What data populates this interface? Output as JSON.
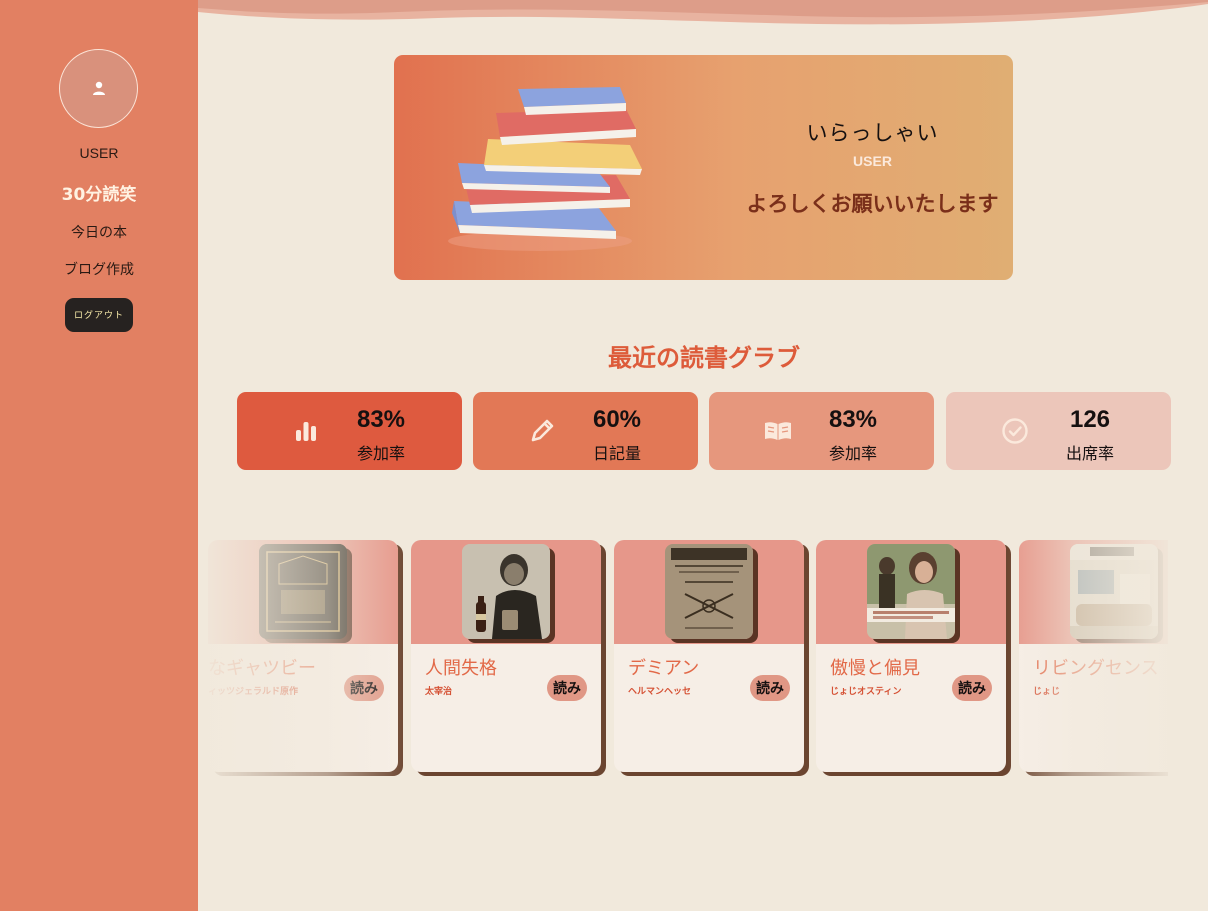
{
  "sidebar": {
    "username": "USER",
    "brand": "30分読笑",
    "nav": [
      {
        "label": "今日の本"
      },
      {
        "label": "ブログ作成"
      }
    ],
    "logout_label": "ログアウト"
  },
  "hero": {
    "greeting": "いらっしゃい",
    "username": "USER",
    "message": "よろしくお願いいたします"
  },
  "stats_section": {
    "title": "最近の読書グラブ",
    "cards": [
      {
        "value": "83%",
        "label": "参加率",
        "icon": "bar-chart-icon"
      },
      {
        "value": "60%",
        "label": "日記量",
        "icon": "pencil-icon"
      },
      {
        "value": "83%",
        "label": "参加率",
        "icon": "open-book-icon"
      },
      {
        "value": "126",
        "label": "出席率",
        "icon": "check-circle-icon"
      }
    ]
  },
  "books": [
    {
      "title": "グレートなギャツビー",
      "title_visible": "なギャツビー",
      "author": "フィッツジェラルド原作",
      "author_visible": "ィッツジェラルド原作",
      "read_label": "読み"
    },
    {
      "title": "人間失格",
      "author": "太宰治",
      "read_label": "読み"
    },
    {
      "title": "デミアン",
      "author": "ヘルマンヘッセ",
      "read_label": "読み"
    },
    {
      "title": "傲慢と偏見",
      "author": "じょじオスティン",
      "read_label": "読み"
    },
    {
      "title": "リビングセンス",
      "title_visible": "リビングセンス",
      "author": "じょじ",
      "read_label": "読み"
    }
  ],
  "colors": {
    "sidebar": "#e28062",
    "background": "#f1e9dc",
    "accent": "#dd5b3a"
  }
}
